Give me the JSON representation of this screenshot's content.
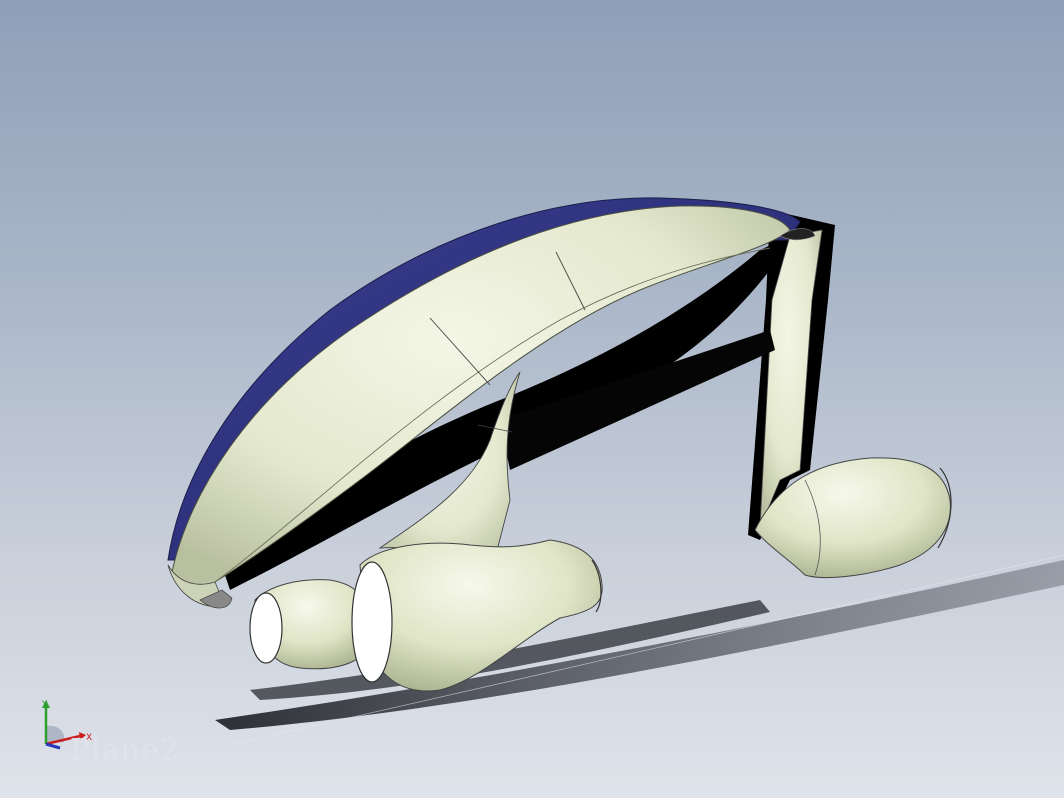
{
  "viewport": {
    "background_top": "#8f9fb8",
    "background_bottom": "#dfe3ea"
  },
  "model": {
    "body_color": "#e3e8cd",
    "top_stripe_color": "#2c2f7a",
    "underside_color": "#000000"
  },
  "triad": {
    "x_label": "X",
    "y_label": "Y",
    "x_color": "#cc1f1f",
    "y_color": "#2e9e2e",
    "z_color": "#2438b8"
  },
  "plane_label": "Plane2"
}
